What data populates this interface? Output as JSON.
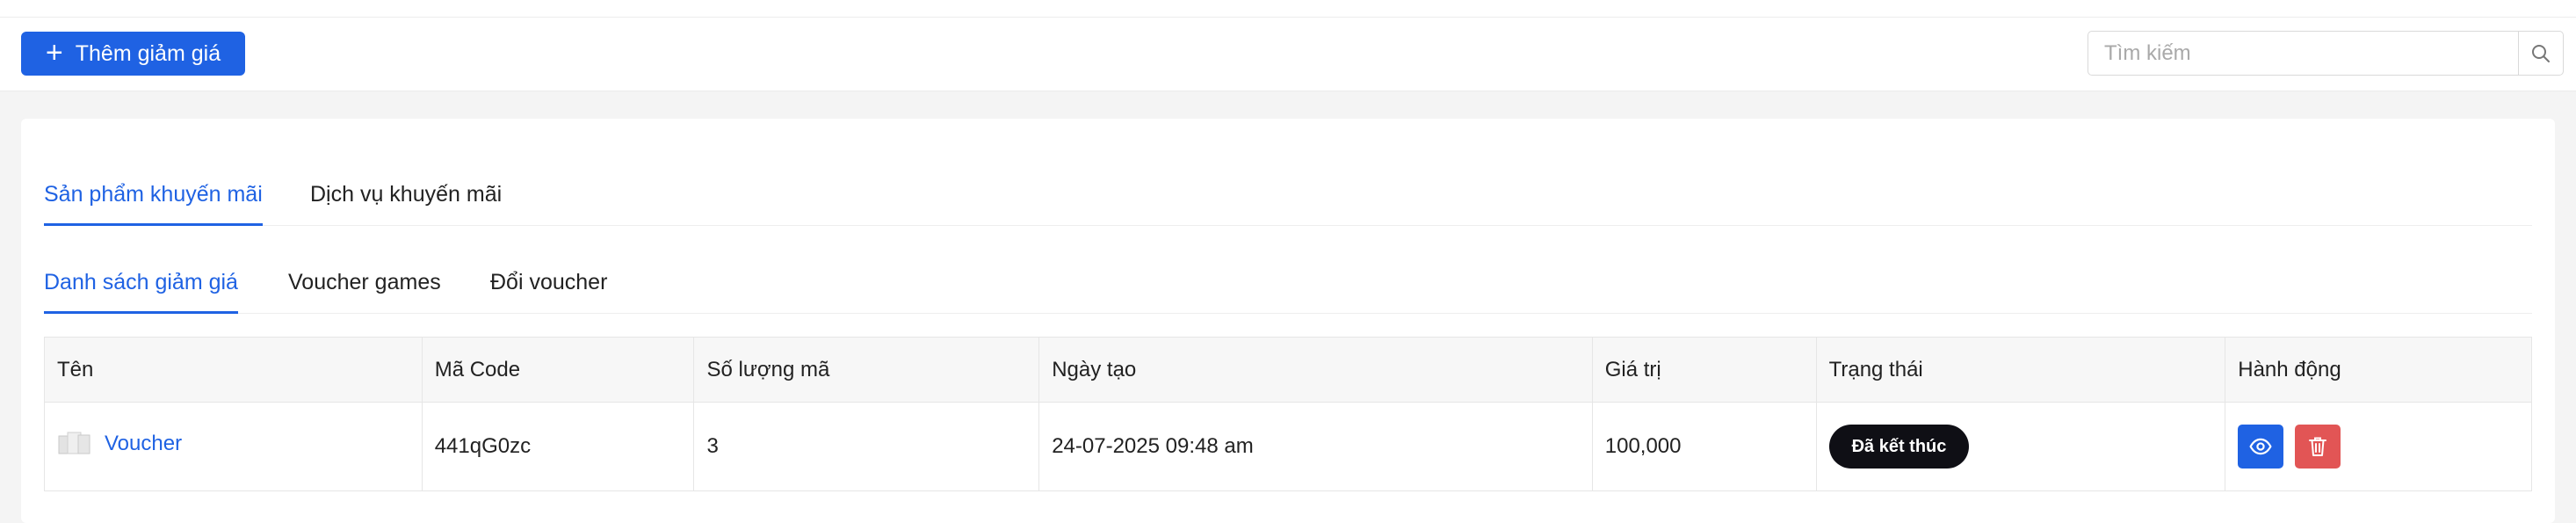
{
  "toolbar": {
    "add_label": "Thêm giảm giá",
    "search_placeholder": "Tìm kiếm",
    "search_value": ""
  },
  "tabs_primary": [
    {
      "label": "Sản phẩm khuyến mãi",
      "active": true
    },
    {
      "label": "Dịch vụ khuyến mãi",
      "active": false
    }
  ],
  "tabs_secondary": [
    {
      "label": "Danh sách giảm giá",
      "active": true
    },
    {
      "label": "Voucher games",
      "active": false
    },
    {
      "label": "Đổi voucher",
      "active": false
    }
  ],
  "table": {
    "columns": [
      "Tên",
      "Mã Code",
      "Số lượng mã",
      "Ngày tạo",
      "Giá trị",
      "Trạng thái",
      "Hành động"
    ],
    "rows": [
      {
        "name": "Voucher",
        "code": "441qG0zc",
        "quantity": "3",
        "created": "24-07-2025 09:48 am",
        "value": "100,000",
        "status": "Đã kết thúc"
      }
    ]
  },
  "colors": {
    "accent": "#1f62e3",
    "danger": "#e25555",
    "status_bg": "#0f0f15"
  },
  "icons": {
    "add": "plus-icon",
    "search": "search-icon",
    "thumb": "image-thumbnail-icon",
    "view": "eye-icon",
    "delete": "trash-icon"
  }
}
